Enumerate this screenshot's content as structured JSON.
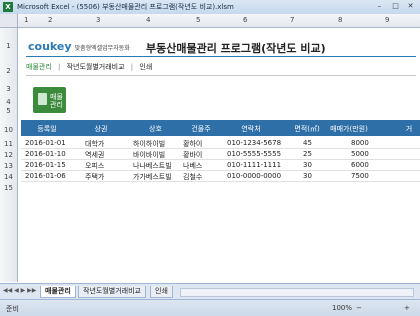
{
  "window": {
    "title": "Microsoft Excel - (5506) 부동산매물관리 프로그램(작년도 비교).xlsm",
    "app_icon": "X"
  },
  "columns": [
    "1",
    "2",
    "3",
    "4",
    "5",
    "6",
    "7",
    "8",
    "9"
  ],
  "rows": [
    "1",
    "2",
    "3",
    "4",
    "5",
    "10",
    "11",
    "12",
    "13",
    "14",
    "15"
  ],
  "logo": {
    "brand": "coukey",
    "tagline": "맞춤형엑셀업무자동화"
  },
  "page_title": "부동산매물관리 프로그램(작년도 비교)",
  "nav": {
    "items": [
      "매물관리",
      "작년도월별거래비교",
      "인쇄"
    ],
    "sep": "|"
  },
  "button": {
    "label_line1": "매물",
    "label_line2": "관리"
  },
  "table": {
    "headers": [
      "등록일",
      "상권",
      "상호",
      "건물주",
      "연락처",
      "면적(㎡)",
      "매매가(만원)",
      "거"
    ],
    "rows": [
      [
        "2016-01-01",
        "대학가",
        "하이하이빌",
        "황하이",
        "010-1234-5678",
        "45",
        "8000"
      ],
      [
        "2016-01-10",
        "역세권",
        "바이바이빌",
        "황바이",
        "010-5555-5555",
        "25",
        "5000"
      ],
      [
        "2016-01-15",
        "오피스",
        "나나베스트빌",
        "나베스",
        "010-1111-1111",
        "30",
        "6000"
      ],
      [
        "2016-01-06",
        "주택가",
        "가가베스트빌",
        "김철수",
        "010-0000-0000",
        "30",
        "7500"
      ]
    ]
  },
  "sheet_tabs": [
    "매물관리",
    "작년도월별거래비교",
    "인쇄"
  ],
  "status": {
    "ready": "준비",
    "zoom": "100%"
  }
}
